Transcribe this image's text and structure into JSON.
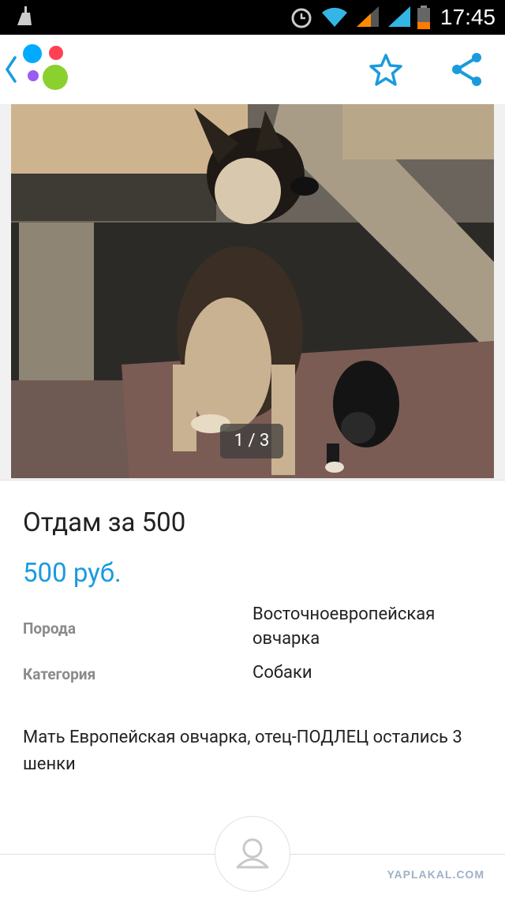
{
  "status_bar": {
    "time": "17:45"
  },
  "gallery": {
    "counter": "1 / 3"
  },
  "listing": {
    "title": "Отдам за 500",
    "price": "500 руб.",
    "params": [
      {
        "label": "Порода",
        "value": "Восточноевропейская овчарка"
      },
      {
        "label": "Категория",
        "value": "Собаки"
      }
    ],
    "description": "Мать Европейская овчарка, отец-ПОДЛЕЦ остались 3 шенки"
  },
  "watermark": "YAPLAKAL.COM",
  "colors": {
    "accent": "#1a9bde",
    "logo_blue": "#00aaff",
    "logo_red": "#ff4053",
    "logo_purple": "#9b5cf0",
    "logo_green": "#8ad12f"
  }
}
